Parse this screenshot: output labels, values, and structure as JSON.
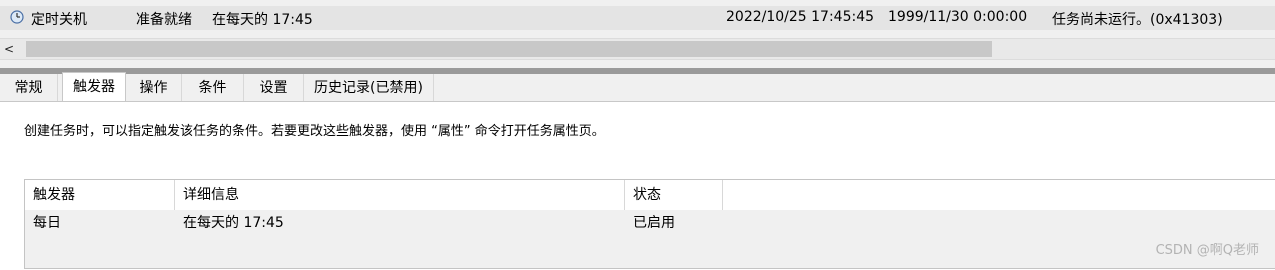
{
  "task": {
    "name": "定时关机",
    "status": "准备就绪",
    "trigger": "在每天的 17:45",
    "next_run": "2022/10/25 17:45:45",
    "last_run": "1999/11/30 0:00:00",
    "last_result": "任务尚未运行。(0x41303)"
  },
  "scrollbar": {
    "left_arrow": "<"
  },
  "tabs": [
    "常规",
    "触发器",
    "操作",
    "条件",
    "设置",
    "历史记录(已禁用)"
  ],
  "active_tab": "触发器",
  "description": "创建任务时，可以指定触发该任务的条件。若要更改这些触发器，使用 “属性” 命令打开任务属性页。",
  "triggers_table": {
    "headers": [
      "触发器",
      "详细信息",
      "状态"
    ],
    "rows": [
      {
        "trigger": "每日",
        "details": "在每天的 17:45",
        "status": "已启用"
      }
    ]
  },
  "watermark": "CSDN @啊Q老师"
}
